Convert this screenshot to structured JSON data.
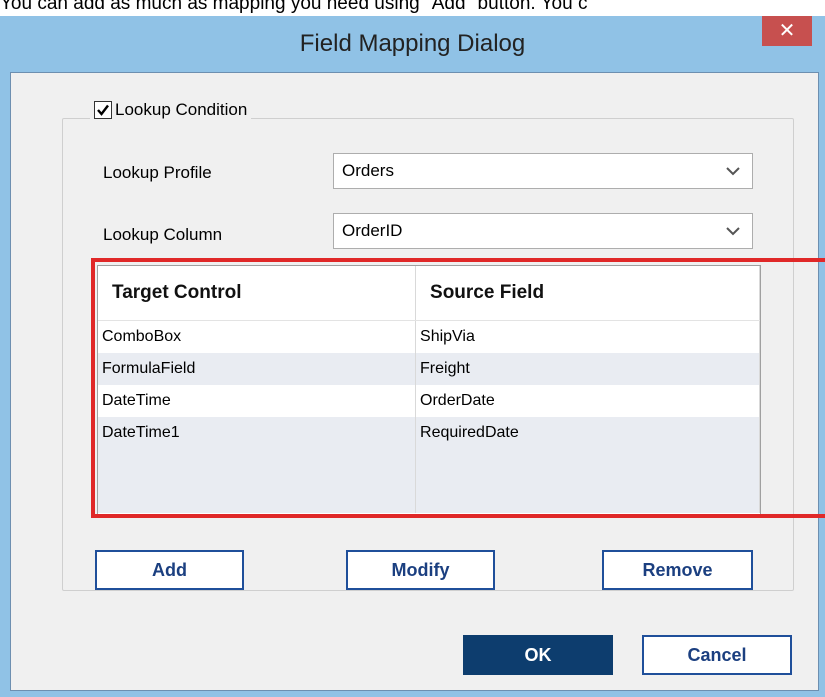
{
  "caption": "You can add as much as mapping you need using \"Add\" button. You c",
  "dialog": {
    "title": "Field Mapping Dialog",
    "close_glyph": "✕"
  },
  "lookup": {
    "checkbox_label": "Lookup Condition",
    "checked": true,
    "profile_label": "Lookup Profile",
    "profile_value": "Orders",
    "column_label": "Lookup Column",
    "column_value": "OrderID"
  },
  "grid": {
    "columns": [
      "Target Control",
      "Source Field"
    ],
    "rows": [
      [
        "ComboBox",
        "ShipVia"
      ],
      [
        "FormulaField",
        "Freight"
      ],
      [
        "DateTime",
        "OrderDate"
      ],
      [
        "DateTime1",
        "RequiredDate"
      ]
    ]
  },
  "buttons": {
    "add": "Add",
    "modify": "Modify",
    "remove": "Remove",
    "ok": "OK",
    "cancel": "Cancel"
  },
  "colors": {
    "accent_primary": "#0d3d6e",
    "highlight": "#e02828",
    "close": "#c7504f",
    "frame": "#90c2e6"
  }
}
